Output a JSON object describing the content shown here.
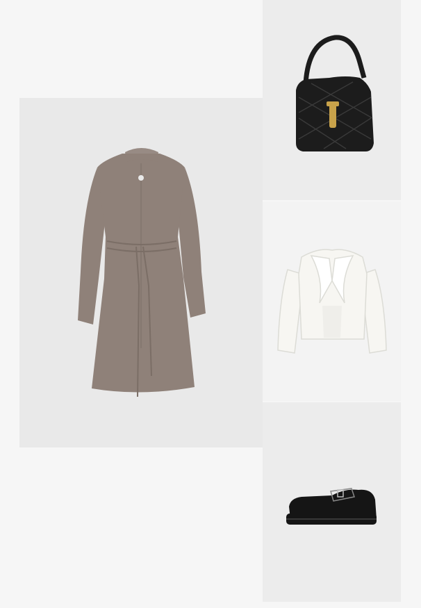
{
  "outfit": {
    "items": [
      {
        "name": "dress",
        "tile_color": "#e9e9e9",
        "item_color": "#8f8179"
      },
      {
        "name": "handbag",
        "tile_color": "#ececec",
        "item_color": "#1c1c1c",
        "hardware_color": "#c8a24a"
      },
      {
        "name": "blazer",
        "tile_color": "#f3f3f3",
        "item_color": "#f7f6f2"
      },
      {
        "name": "shoes",
        "tile_color": "#ececec",
        "item_color": "#151515"
      }
    ]
  },
  "colors": {
    "page_background": "#f6f6f6"
  }
}
